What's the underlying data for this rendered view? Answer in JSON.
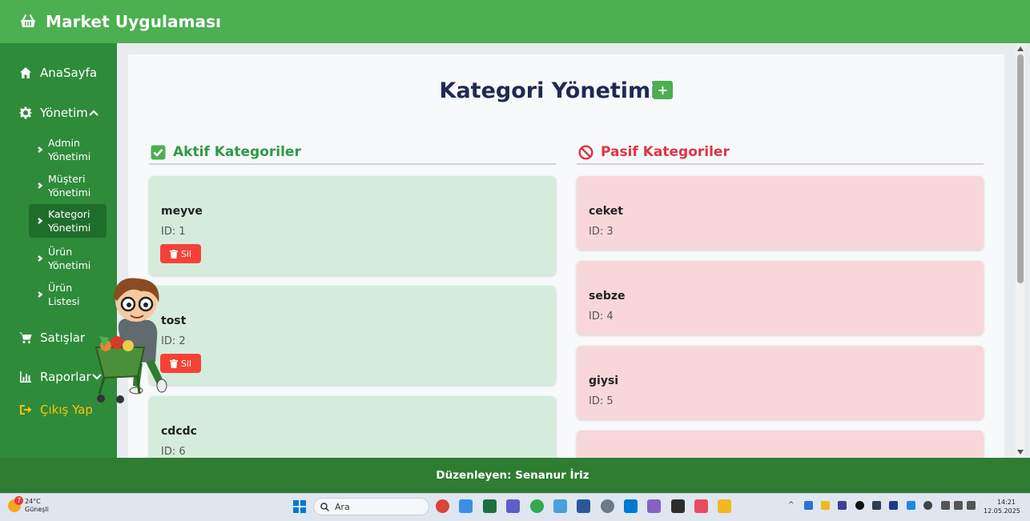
{
  "app": {
    "title": "Market Uygulaması"
  },
  "sidebar": {
    "home": "AnaSayfa",
    "management": "Yönetim",
    "sub_items": [
      {
        "line1": "Admin",
        "line2": "Yönetimi"
      },
      {
        "line1": "Müşteri",
        "line2": "Yönetimi"
      },
      {
        "line1": "Kategori",
        "line2": "Yönetimi"
      },
      {
        "line1": "Ürün",
        "line2": "Yönetimi"
      },
      {
        "line1": "Ürün",
        "line2": "Listesi"
      }
    ],
    "sales": "Satışlar",
    "reports": "Raporlar",
    "logout": "Çıkış Yap"
  },
  "main": {
    "title": "Kategori Yönetimi",
    "add_label": "+",
    "active_heading": "Aktif Kategoriler",
    "passive_heading": "Pasif Kategoriler",
    "delete_label": "Sil",
    "active_categories": [
      {
        "name": "meyve",
        "id": "ID: 1"
      },
      {
        "name": "tost",
        "id": "ID: 2"
      },
      {
        "name": "cdcdc",
        "id": "ID: 6"
      }
    ],
    "passive_categories": [
      {
        "name": "ceket",
        "id": "ID: 3"
      },
      {
        "name": "sebze",
        "id": "ID: 4"
      },
      {
        "name": "giysi",
        "id": "ID: 5"
      }
    ]
  },
  "footer": {
    "text": "Düzenleyen: Senanur İriz"
  },
  "taskbar": {
    "weather_badge": "7",
    "temperature": "24°C",
    "weather_desc": "Güneşli",
    "search_placeholder": "Ara",
    "time": "14:21",
    "date": "12.05.2025"
  },
  "colors": {
    "header": "#4caf50",
    "sidebar": "#2e8b3a",
    "active_card": "#d5ecdc",
    "passive_card": "#f8d7da",
    "danger": "#f44336",
    "footer": "#2e7d32"
  }
}
